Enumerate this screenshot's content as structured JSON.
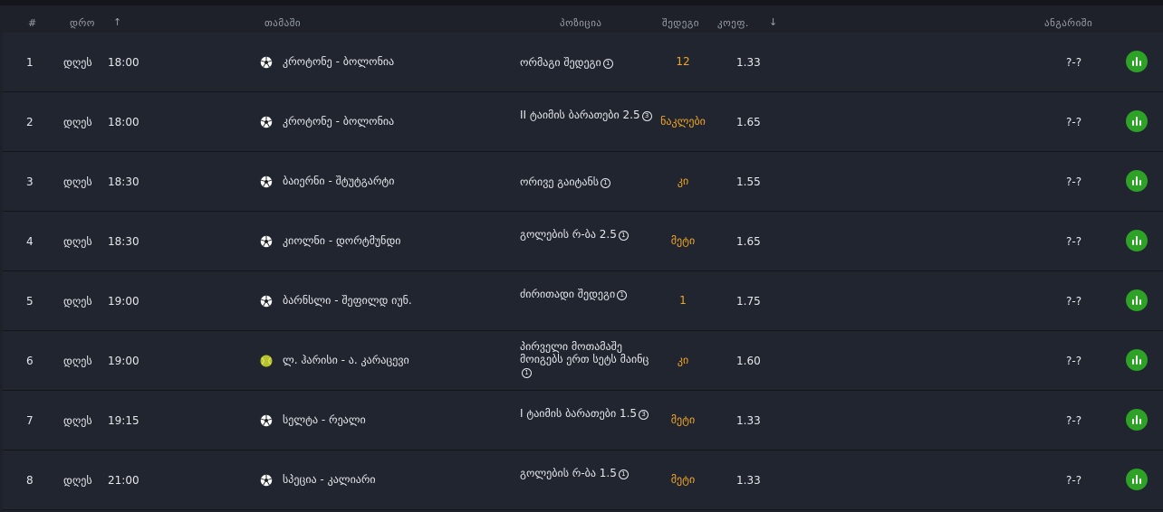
{
  "header": {
    "num": "#",
    "time": "დრო",
    "game": "თამაში",
    "position": "პოზიცია",
    "result": "შედეგი",
    "coef": "კოეფ.",
    "score": "ანგარიში"
  },
  "colors": {
    "accent": "#f2a623",
    "live": "#2ea227",
    "background": "#1e2129"
  },
  "rows": [
    {
      "num": "1",
      "date": "დღეს",
      "time": "18:00",
      "sport_icon": "soccer-ball-icon",
      "game": "კროტონე - ბოლონია",
      "position": "ორმაგი შედეგი",
      "info": "1",
      "result": "12",
      "coef": "1.33",
      "score": "?-?"
    },
    {
      "num": "2",
      "date": "დღეს",
      "time": "18:00",
      "sport_icon": "soccer-ball-icon",
      "game": "კროტონე - ბოლონია",
      "position": "II ტაიმის ბარათები 2.5",
      "info": "3",
      "result": "ნაკლები",
      "coef": "1.65",
      "score": "?-?"
    },
    {
      "num": "3",
      "date": "დღეს",
      "time": "18:30",
      "sport_icon": "soccer-ball-icon",
      "game": "ბაიერნი - შტუტგარტი",
      "position": "ორივე გაიტანს",
      "info": "1",
      "result": "კი",
      "coef": "1.55",
      "score": "?-?"
    },
    {
      "num": "4",
      "date": "დღეს",
      "time": "18:30",
      "sport_icon": "soccer-ball-icon",
      "game": "კიოლნი - დორტმუნდი",
      "position": "გოლების რ-ბა 2.5",
      "info": "1",
      "result": "მეტი",
      "coef": "1.65",
      "score": "?-?"
    },
    {
      "num": "5",
      "date": "დღეს",
      "time": "19:00",
      "sport_icon": "soccer-ball-icon",
      "game": "ბარნსლი - შეფილდ იუნ.",
      "position": "ძირითადი შედეგი",
      "info": "1",
      "result": "1",
      "coef": "1.75",
      "score": "?-?"
    },
    {
      "num": "6",
      "date": "დღეს",
      "time": "19:00",
      "sport_icon": "tennis-ball-icon",
      "game": "ლ. ჰარისი - ა. კარაცევი",
      "position": "პირველი მოთამაშე მოიგებს ერთ სეტს მაინც",
      "info": "1",
      "result": "კი",
      "coef": "1.60",
      "score": "?-?"
    },
    {
      "num": "7",
      "date": "დღეს",
      "time": "19:15",
      "sport_icon": "soccer-ball-icon",
      "game": "სელტა - რეალი",
      "position": "I ტაიმის ბარათები 1.5",
      "info": "3",
      "result": "მეტი",
      "coef": "1.33",
      "score": "?-?"
    },
    {
      "num": "8",
      "date": "დღეს",
      "time": "21:00",
      "sport_icon": "soccer-ball-icon",
      "game": "სპეცია - კალიარი",
      "position": "გოლების რ-ბა 1.5",
      "info": "1",
      "result": "მეტი",
      "coef": "1.33",
      "score": "?-?"
    }
  ]
}
